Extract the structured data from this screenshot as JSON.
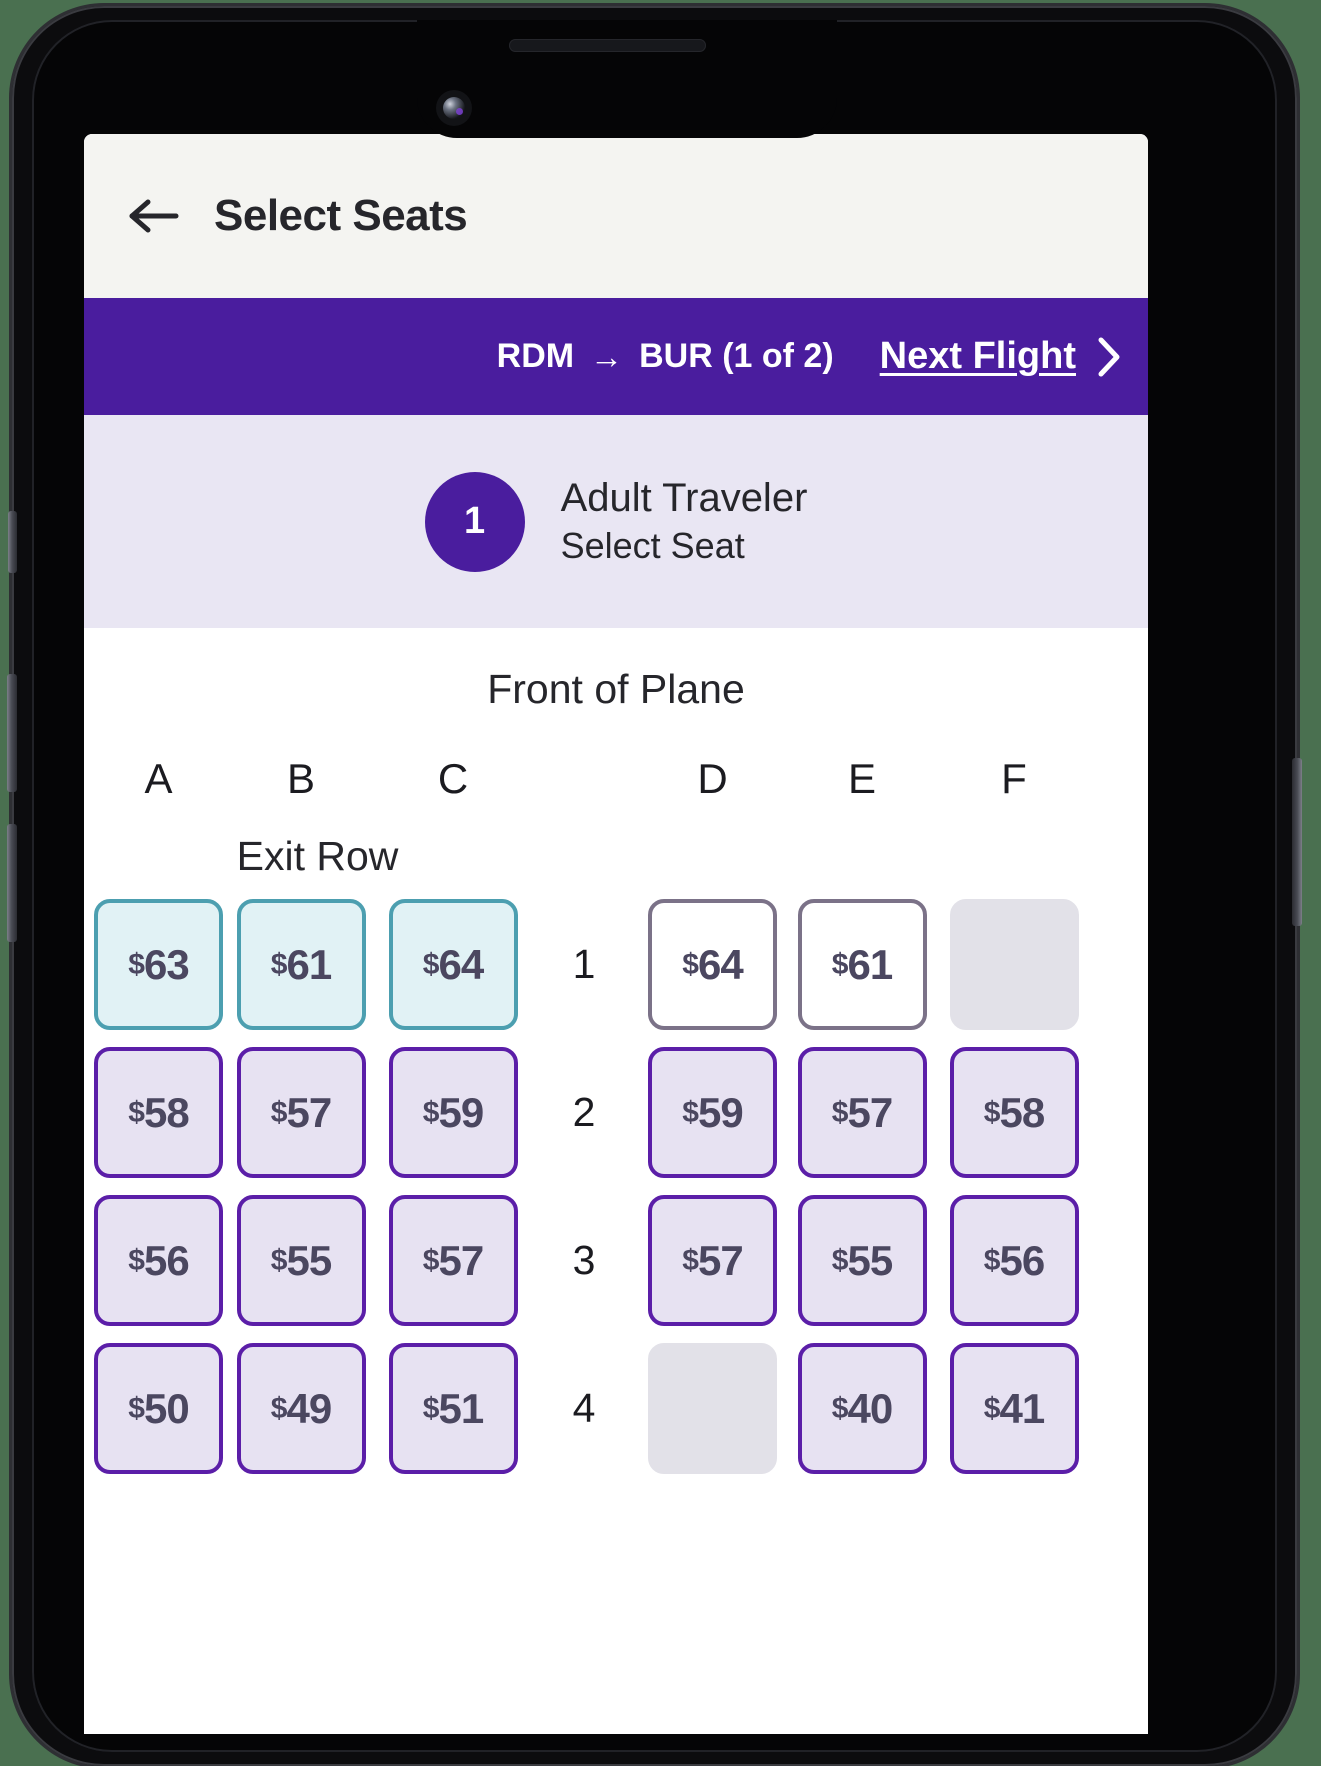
{
  "header": {
    "back_icon": "back-arrow-icon",
    "title": "Select Seats"
  },
  "flight_bar": {
    "origin": "RDM",
    "arrow": "→",
    "destination_and_count": "BUR (1 of 2)",
    "next_flight_label": "Next Flight",
    "chevron_icon": "chevron-right-icon",
    "background_color": "#4a1d9e"
  },
  "traveler": {
    "number": "1",
    "title": "Adult Traveler",
    "subtitle": "Select Seat",
    "badge_color": "#4a1d9e",
    "strip_color": "#e9e6f3"
  },
  "seat_map": {
    "front_label": "Front of Plane",
    "exit_row_label": "Exit Row",
    "columns": [
      "A",
      "B",
      "C",
      "D",
      "E",
      "F"
    ],
    "colors": {
      "available_border": "#5b1ea8",
      "available_fill": "#e7e2f2",
      "exit_border": "#4c9fb0",
      "exit_fill": "#e1f2f5",
      "premium_border": "#7b7288",
      "premium_fill": "#ffffff",
      "unavailable_fill": "#e2e1e8",
      "price_text": "#4b4760"
    },
    "rows": [
      {
        "number": "1",
        "seats": [
          {
            "col": "A",
            "price": "$63",
            "state": "exit"
          },
          {
            "col": "B",
            "price": "$61",
            "state": "exit"
          },
          {
            "col": "C",
            "price": "$64",
            "state": "exit"
          },
          {
            "col": "D",
            "price": "$64",
            "state": "premium"
          },
          {
            "col": "E",
            "price": "$61",
            "state": "premium"
          },
          {
            "col": "F",
            "price": "",
            "state": "unavailable"
          }
        ]
      },
      {
        "number": "2",
        "seats": [
          {
            "col": "A",
            "price": "$58",
            "state": "available"
          },
          {
            "col": "B",
            "price": "$57",
            "state": "available"
          },
          {
            "col": "C",
            "price": "$59",
            "state": "available"
          },
          {
            "col": "D",
            "price": "$59",
            "state": "available"
          },
          {
            "col": "E",
            "price": "$57",
            "state": "available"
          },
          {
            "col": "F",
            "price": "$58",
            "state": "available"
          }
        ]
      },
      {
        "number": "3",
        "seats": [
          {
            "col": "A",
            "price": "$56",
            "state": "available"
          },
          {
            "col": "B",
            "price": "$55",
            "state": "available"
          },
          {
            "col": "C",
            "price": "$57",
            "state": "available"
          },
          {
            "col": "D",
            "price": "$57",
            "state": "available"
          },
          {
            "col": "E",
            "price": "$55",
            "state": "available"
          },
          {
            "col": "F",
            "price": "$56",
            "state": "available"
          }
        ]
      },
      {
        "number": "4",
        "seats": [
          {
            "col": "A",
            "price": "$50",
            "state": "available"
          },
          {
            "col": "B",
            "price": "$49",
            "state": "available"
          },
          {
            "col": "C",
            "price": "$51",
            "state": "available"
          },
          {
            "col": "D",
            "price": "",
            "state": "unavailable"
          },
          {
            "col": "E",
            "price": "$40",
            "state": "available"
          },
          {
            "col": "F",
            "price": "$41",
            "state": "available"
          }
        ]
      }
    ]
  }
}
